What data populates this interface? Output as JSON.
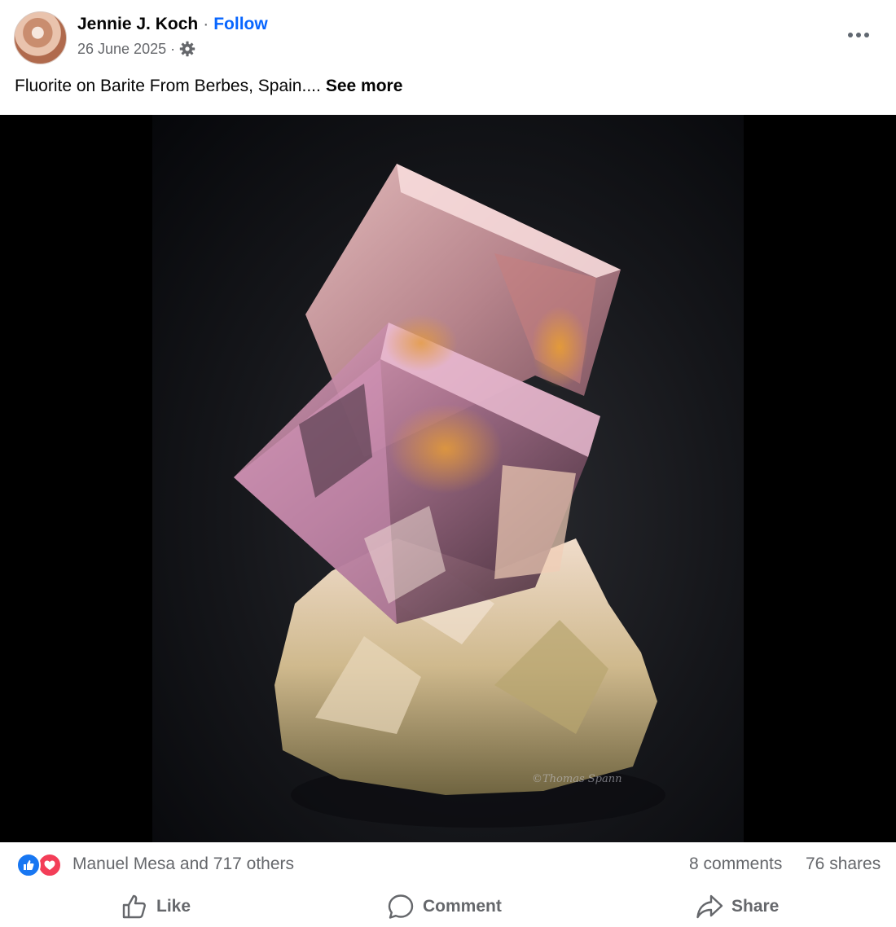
{
  "post": {
    "author": "Jennie J. Koch",
    "separator": "·",
    "follow_label": "Follow",
    "date": "26 June 2025",
    "audience_icon": "gear-icon",
    "more_icon": "more-options-icon",
    "caption": "Fluorite on Barite From Berbes, Spain....",
    "see_more_label": "See more",
    "image_watermark": "©Thomas Spann"
  },
  "stats": {
    "reactions": [
      "like",
      "love"
    ],
    "reaction_names": "Manuel Mesa and 717 others",
    "comments": "8 comments",
    "shares": "76 shares"
  },
  "actions": {
    "like_label": "Like",
    "comment_label": "Comment",
    "share_label": "Share"
  },
  "colors": {
    "accent": "#0866ff",
    "secondary_text": "#65676b",
    "like_blue": "#1877f2",
    "love_red": "#f33e58"
  }
}
